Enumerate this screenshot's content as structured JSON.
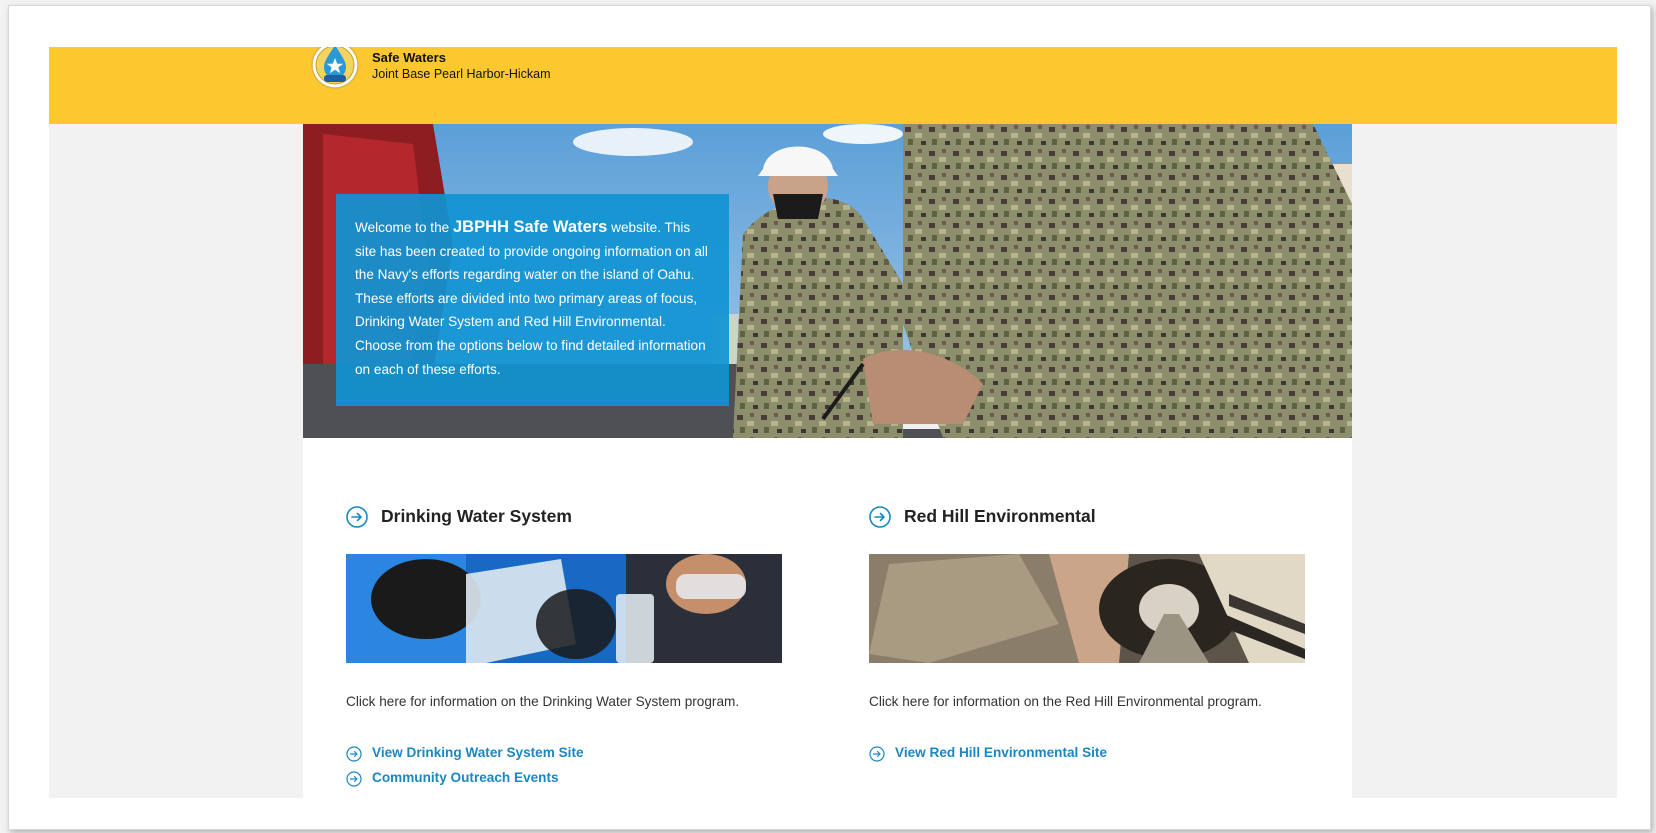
{
  "header": {
    "title": "Safe Waters",
    "subtitle": "Joint Base Pearl Harbor-Hickam",
    "logo_text": "SAFE WATERS"
  },
  "hero": {
    "welcome_prefix": "Welcome to the ",
    "welcome_emphasis": "JBPHH Safe Waters",
    "welcome_suffix": " website. This site has been created to provide ongoing information on all the Navy's efforts regarding water on the island of Oahu. These efforts are divided into two primary areas of focus, Drinking Water System and Red Hill Environmental. Choose from the options below to find detailed information on each of these efforts."
  },
  "sections": [
    {
      "title": "Drinking Water System",
      "description": "Click here for information on the Drinking Water System program.",
      "links": [
        "View Drinking Water System Site",
        "Community Outreach Events"
      ]
    },
    {
      "title": "Red Hill Environmental",
      "description": "Click here for information on the Red Hill Environmental program.",
      "links": [
        "View Red Hill Environmental Site"
      ]
    }
  ],
  "colors": {
    "header_bg": "#fdc82f",
    "welcome_bg": "#1094d2",
    "link": "#1a88c0",
    "page_bg": "#f2f2f2"
  },
  "icons": {
    "section_heading": "circle-arrow-right-icon",
    "link_bullet": "circle-arrow-right-icon"
  }
}
